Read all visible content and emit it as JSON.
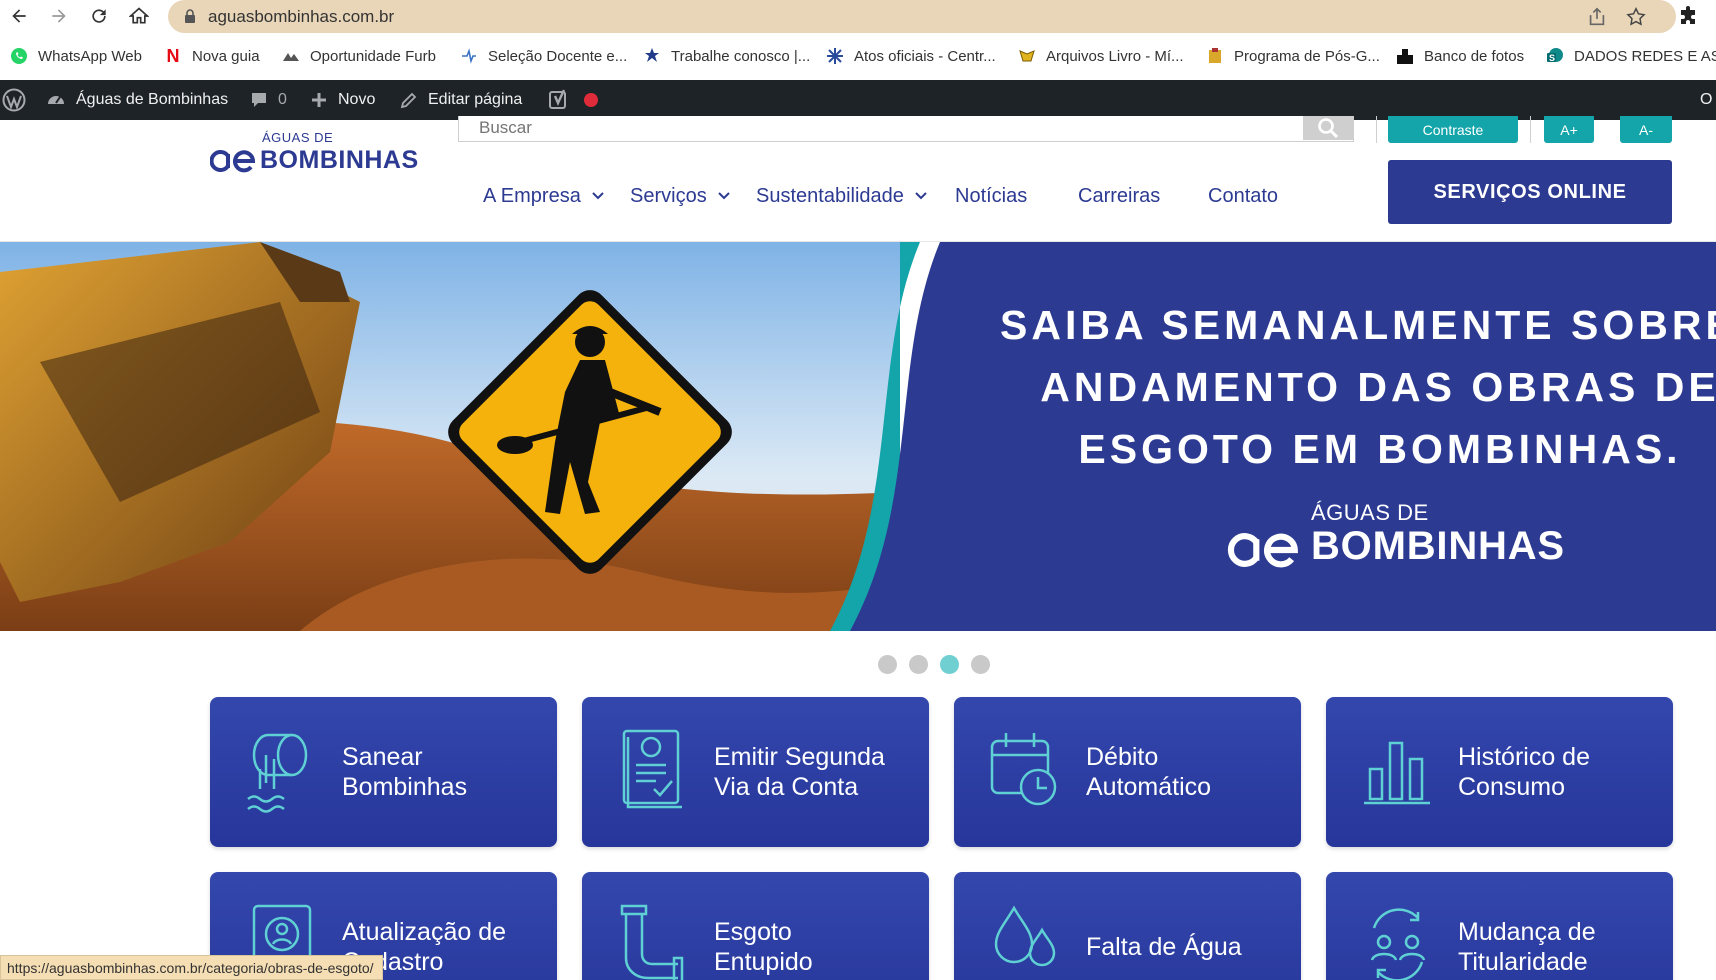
{
  "browser": {
    "url": "aguasbombinhas.com.br",
    "bookmarks": [
      {
        "label": "WhatsApp Web",
        "icon": "whatsapp-icon"
      },
      {
        "label": "Nova guia",
        "icon": "netflix-icon"
      },
      {
        "label": "Oportunidade Furb",
        "icon": "furb-icon"
      },
      {
        "label": "Seleção Docente e...",
        "icon": "selecao-icon"
      },
      {
        "label": "Trabalhe conosco |...",
        "icon": "trabalhe-icon"
      },
      {
        "label": "Atos oficiais - Centr...",
        "icon": "atos-icon"
      },
      {
        "label": "Arquivos Livro - Mí...",
        "icon": "arquivos-icon"
      },
      {
        "label": "Programa de Pós-G...",
        "icon": "programa-icon"
      },
      {
        "label": "Banco de fotos",
        "icon": "banco-fotos-icon"
      },
      {
        "label": "DADOS REDES E AS...",
        "icon": "sharepoint-icon"
      }
    ]
  },
  "adminbar": {
    "site_name": "Águas de Bombinhas",
    "comments_count": "0",
    "new_label": "Novo",
    "edit_label": "Editar página",
    "right_cut": "O"
  },
  "header": {
    "logo_small": "ÁGUAS DE",
    "logo_big": "BOMBINHAS",
    "search_placeholder": "Buscar",
    "contrast_label": "Contraste",
    "font_plus_label": "A+",
    "font_minus_label": "A-",
    "nav": [
      {
        "label": "A Empresa",
        "dropdown": true
      },
      {
        "label": "Serviços",
        "dropdown": true
      },
      {
        "label": "Sustentabilidade",
        "dropdown": true
      },
      {
        "label": "Notícias",
        "dropdown": false
      },
      {
        "label": "Carreiras",
        "dropdown": false
      },
      {
        "label": "Contato",
        "dropdown": false
      }
    ],
    "online_button": "SERVIÇOS ONLINE"
  },
  "hero": {
    "line1": "SAIBA SEMANALMENTE SOBRE O",
    "line2": "ANDAMENTO DAS OBRAS DE",
    "line3": "ESGOTO EM BOMBINHAS.",
    "logo_small": "ÁGUAS DE",
    "logo_big": "BOMBINHAS",
    "colors": {
      "panel": "#2c3a92",
      "accent": "#13a5a9",
      "sign": "#f6b20c"
    }
  },
  "carousel": {
    "total": 4,
    "active_index": 2
  },
  "cards": [
    {
      "line1": "Sanear",
      "line2": "Bombinhas",
      "icon": "pipe-water-icon"
    },
    {
      "line1": "Emitir Segunda",
      "line2": "Via da Conta",
      "icon": "document-icon"
    },
    {
      "line1": "Débito",
      "line2": "Automático",
      "icon": "calendar-clock-icon"
    },
    {
      "line1": "Histórico de",
      "line2": "Consumo",
      "icon": "bar-chart-icon"
    },
    {
      "line1": "Atualização de",
      "line2": "Cadastro",
      "icon": "profile-icon"
    },
    {
      "line1": "Esgoto",
      "line2": "Entupido",
      "icon": "sewer-pipe-icon"
    },
    {
      "line1": "Falta de Água",
      "line2": "",
      "icon": "water-drops-icon"
    },
    {
      "line1": "Mudança de",
      "line2": "Titularidade",
      "icon": "users-swap-icon"
    }
  ],
  "status_bar": "https://aguasbombinhas.com.br/categoria/obras-de-esgoto/"
}
